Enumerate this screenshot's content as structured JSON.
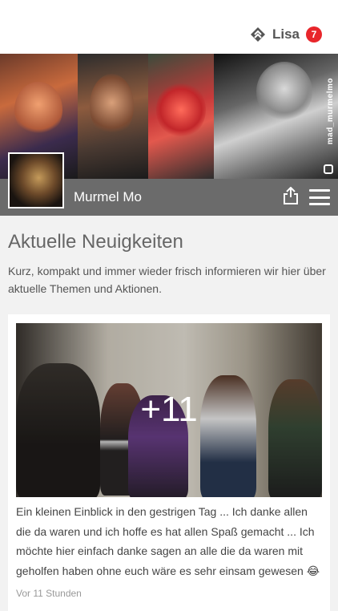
{
  "header": {
    "user_name": "Lisa",
    "notification_count": "7",
    "logo_icon": "app-logo-icon",
    "badge_color": "#e8262b"
  },
  "profile": {
    "name": "Murmel Mo",
    "cover_watermark": "mad_murmelmo",
    "bar_color": "#6b6b6b"
  },
  "section": {
    "title": "Aktuelle Neuigkeiten",
    "intro": "Kurz, kompakt und immer wieder frisch informieren wir hier über aktuelle Themen und Aktionen."
  },
  "post": {
    "more_photos": "+11",
    "text": "Ein kleinen Einblick in den gestrigen Tag ... Ich danke allen die da waren und ich hoffe es hat allen Spaß gemacht ... Ich möchte hier einfach danke sagen an alle die da waren mit geholfen haben ohne euch wäre es sehr einsam gewesen 😂",
    "time": "Vor 11 Stunden"
  }
}
